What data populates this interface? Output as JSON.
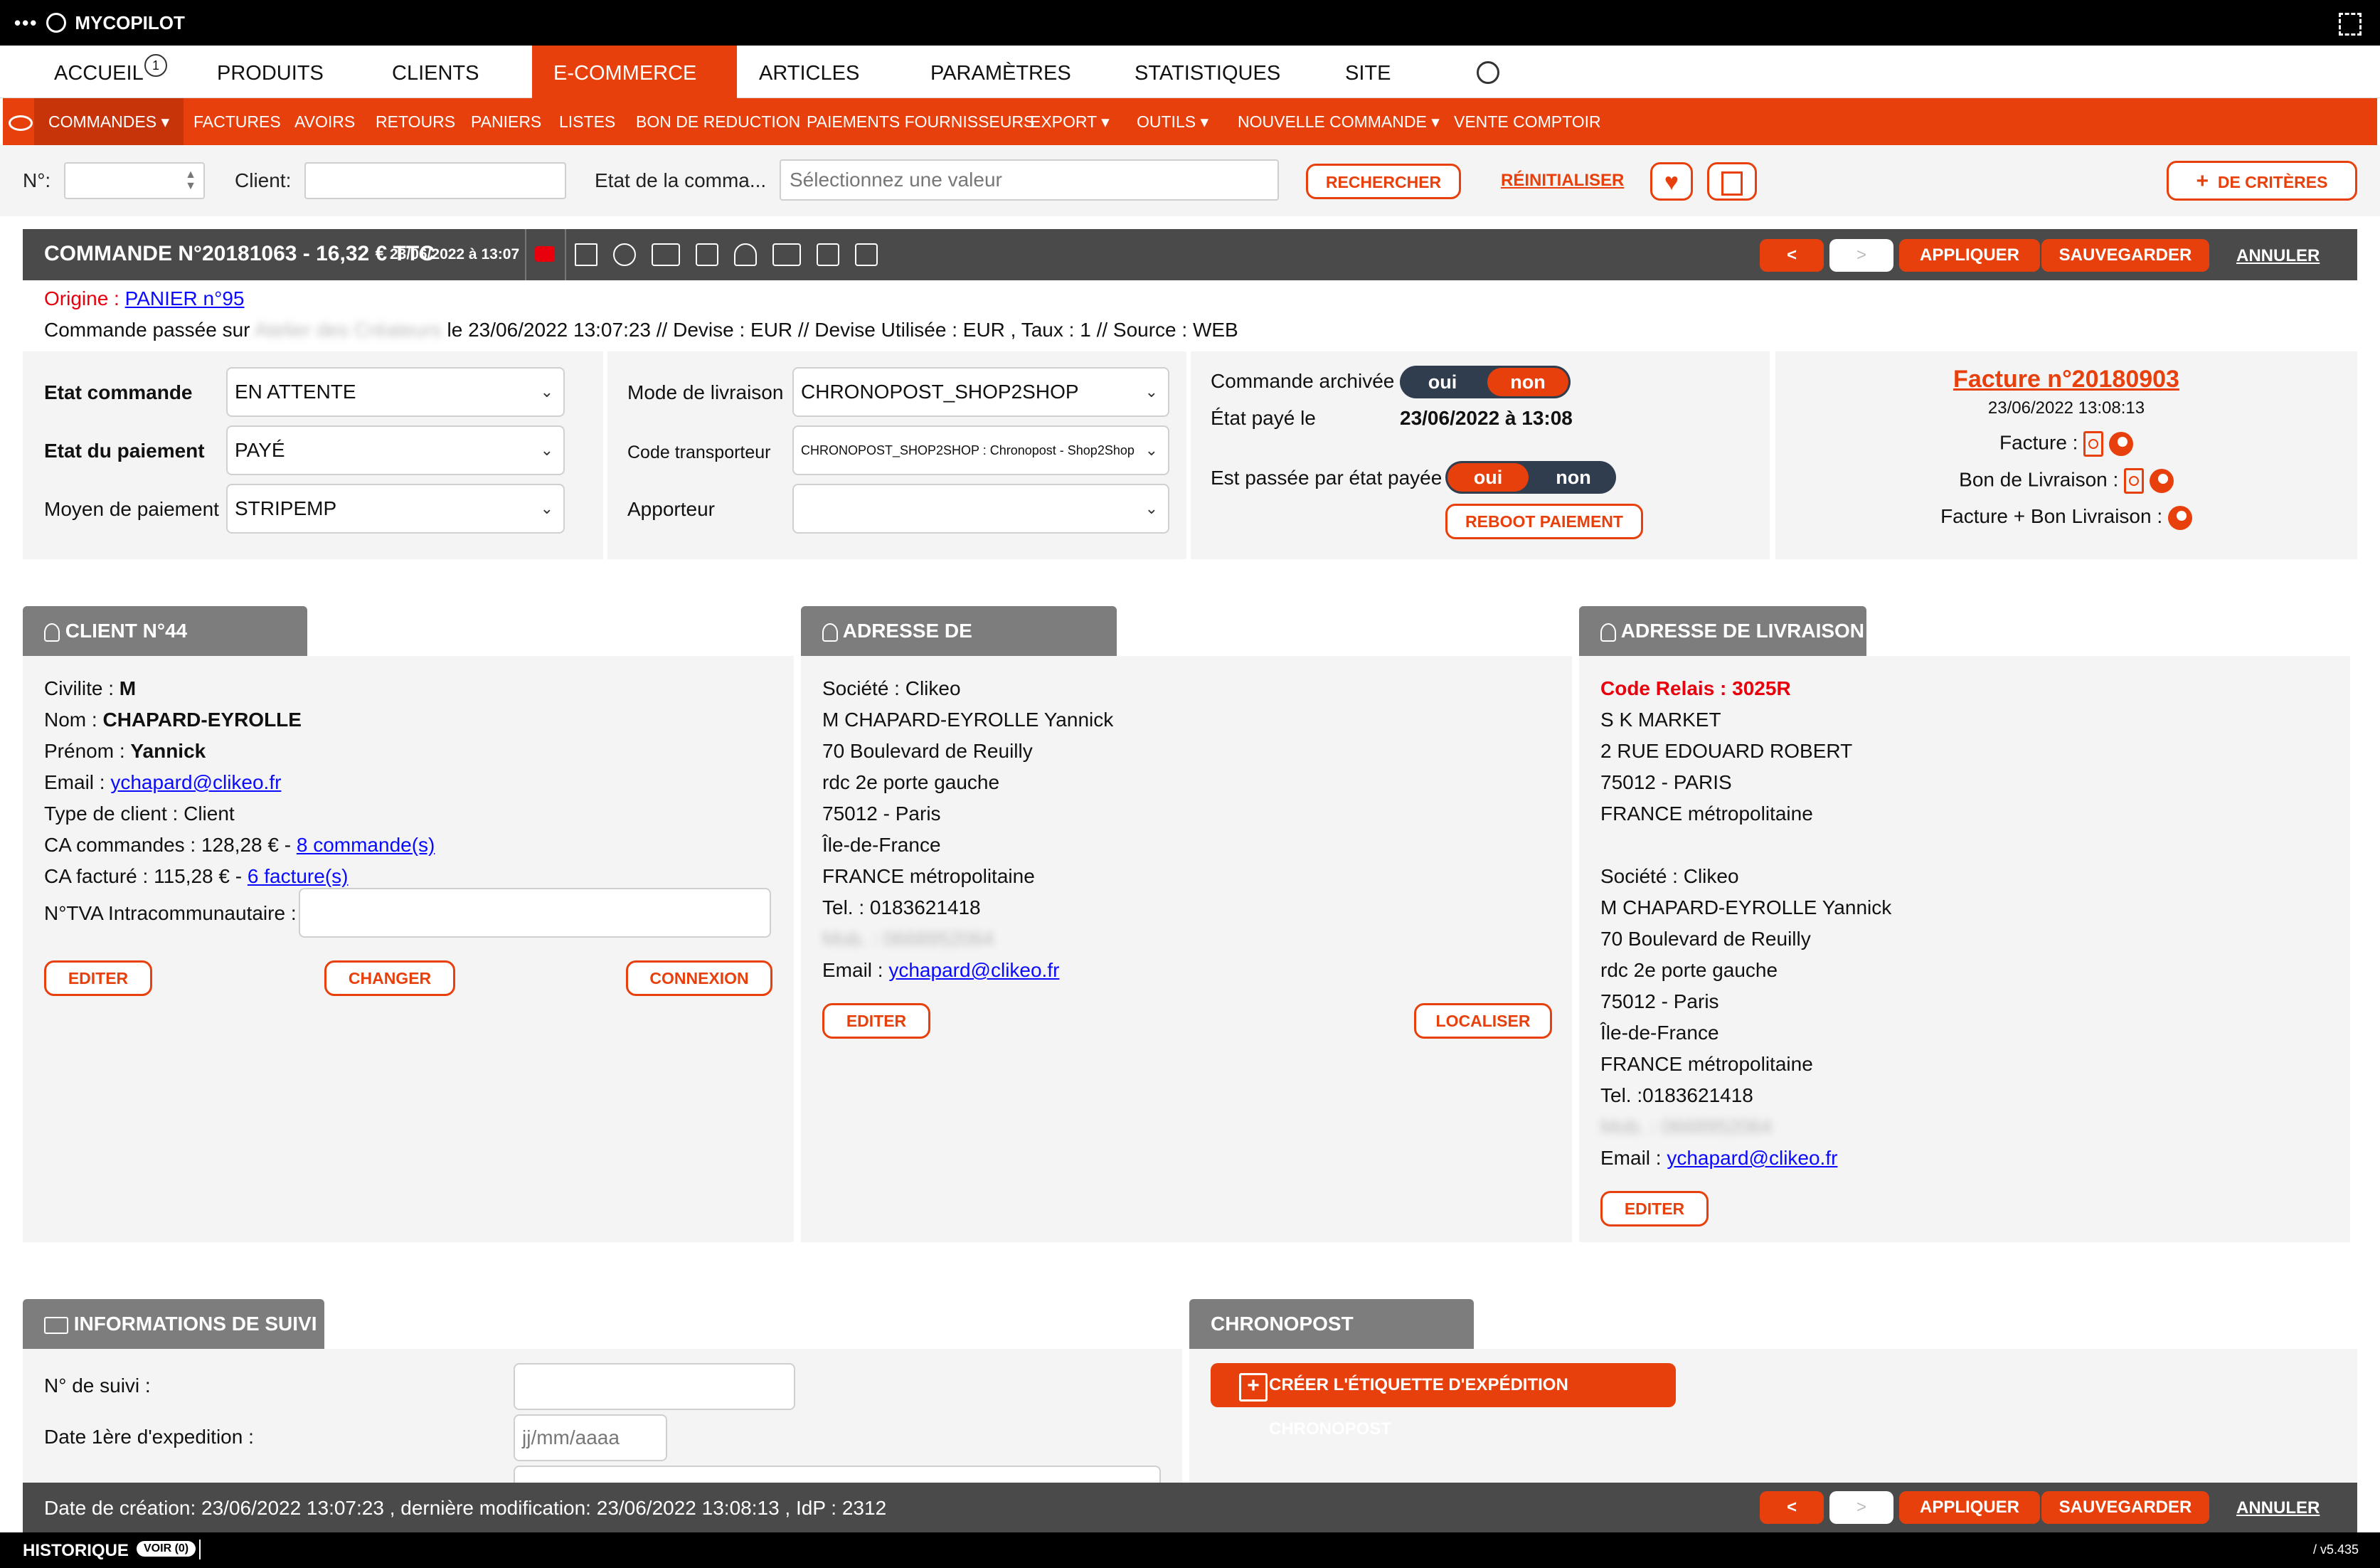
{
  "app": {
    "title": "MYCOPILOT"
  },
  "nav_main": {
    "items": [
      "ACCUEIL",
      "PRODUITS",
      "CLIENTS",
      "E-COMMERCE",
      "ARTICLES",
      "PARAMÈTRES",
      "STATISTIQUES",
      "SITE"
    ],
    "badge": "1"
  },
  "nav_sub": {
    "items": [
      "COMMANDES",
      "FACTURES",
      "AVOIRS",
      "RETOURS",
      "PANIERS",
      "LISTES",
      "BON DE REDUCTION",
      "PAIEMENTS FOURNISSEURS",
      "EXPORT",
      "OUTILS",
      "NOUVELLE COMMANDE",
      "VENTE COMPTOIR"
    ]
  },
  "search": {
    "num_label": "N°:",
    "client_label": "Client:",
    "etat_label": "Etat de la comma...",
    "etat_placeholder": "Sélectionnez une valeur",
    "rechercher": "RECHERCHER",
    "reinitialiser": "RÉINITIALISER",
    "criteres": "DE CRITÈRES"
  },
  "order_bar": {
    "title": "COMMANDE N°20181063 - 16,32 € TTC",
    "date": "23/06/2022 à 13:07",
    "prev": "<",
    "next": ">",
    "appliquer": "APPLIQUER",
    "sauvegarder": "SAUVEGARDER",
    "annuler": "ANNULER"
  },
  "origine": {
    "label": "Origine :",
    "link": "PANIER n°95",
    "line_prefix": "Commande passée sur",
    "line_blur": "Atelier des Créateurs",
    "line_suffix": "le 23/06/2022 13:07:23 // Devise : EUR // Devise Utilisée : EUR , Taux : 1 // Source : WEB"
  },
  "status": {
    "etat_commande_label": "Etat commande",
    "etat_commande": "EN ATTENTE",
    "etat_paiement_label": "Etat du paiement",
    "etat_paiement": "PAYÉ",
    "moyen_label": "Moyen de paiement",
    "moyen": "STRIPEMP",
    "mode_livraison_label": "Mode de livraison",
    "mode_livraison": "CHRONOPOST_SHOP2SHOP",
    "code_transporteur_label": "Code transporteur",
    "code_transporteur": "CHRONOPOST_SHOP2SHOP : Chronopost - Shop2Shop",
    "apporteur_label": "Apporteur",
    "apporteur": "",
    "archivee_label": "Commande archivée",
    "oui": "oui",
    "non": "non",
    "paye_le_label": "État payé le",
    "paye_le": "23/06/2022 à 13:08",
    "passee_label": "Est passée par état payée",
    "reboot": "REBOOT PAIEMENT"
  },
  "facture": {
    "title": "Facture n°20180903",
    "date": "23/06/2022 13:08:13",
    "facture_label": "Facture :",
    "bl_label": "Bon de Livraison :",
    "fbl_label": "Facture + Bon Livraison :"
  },
  "client": {
    "header": "CLIENT N°44",
    "civilite_label": "Civilite :",
    "civilite": "M",
    "nom_label": "Nom :",
    "nom": "CHAPARD-EYROLLE",
    "prenom_label": "Prénom :",
    "prenom": "Yannick",
    "email_label": "Email :",
    "email": "ychapard@clikeo.fr",
    "type_label": "Type de client : Client",
    "ca_cmd_text": "CA commandes : 128,28 € -",
    "ca_cmd_link": "8 commande(s)",
    "ca_fact_text": "CA facturé : 115,28 € -",
    "ca_fact_link": "6 facture(s)",
    "tva_label": "N°TVA Intracommunautaire :",
    "editer": "EDITER",
    "changer": "CHANGER",
    "connexion": "CONNEXION"
  },
  "facturation": {
    "header": "ADRESSE DE FACTURATION",
    "lines": [
      "Société : Clikeo",
      "M CHAPARD-EYROLLE Yannick",
      "70 Boulevard de Reuilly",
      "rdc 2e porte gauche",
      "75012 - Paris",
      "Île-de-France",
      "FRANCE métropolitaine",
      "Tel. : 0183621418"
    ],
    "blur": "Mob. : 0668952064",
    "email_label": "Email :",
    "email": "ychapard@clikeo.fr",
    "editer": "EDITER",
    "localiser": "LOCALISER"
  },
  "livraison": {
    "header": "ADRESSE DE LIVRAISON",
    "relais": "Code Relais : 3025R",
    "lines1": [
      "S K MARKET",
      "2 RUE EDOUARD ROBERT",
      "75012 - PARIS",
      "FRANCE métropolitaine"
    ],
    "lines2": [
      "Société : Clikeo",
      "M CHAPARD-EYROLLE Yannick",
      "70 Boulevard de Reuilly",
      "rdc 2e porte gauche",
      "75012 - Paris",
      "Île-de-France",
      "FRANCE métropolitaine",
      "Tel. :0183621418"
    ],
    "blur": "Mob. : 0668952064",
    "email_label": "Email :",
    "email": "ychapard@clikeo.fr",
    "editer": "EDITER"
  },
  "suivi": {
    "header": "INFORMATIONS DE SUIVI",
    "num_label": "N° de suivi :",
    "date_label": "Date 1ère d'expedition :",
    "date_placeholder": "jj/mm/aaaa"
  },
  "chronopost": {
    "header": "CHRONOPOST",
    "button": "CRÉER L'ÉTIQUETTE D'EXPÉDITION CHRONOPOST"
  },
  "footer_bar": {
    "text": "Date de création: 23/06/2022 13:07:23 , dernière modification: 23/06/2022 13:08:13 , IdP : 2312"
  },
  "bottom": {
    "historique": "HISTORIQUE",
    "voir": "VOIR (0)",
    "version": "/ v5.435"
  },
  "colors": {
    "accent": "#e8400c",
    "dark": "#4a4a4a",
    "panel": "#f4f4f4",
    "link": "#0a0aff",
    "relais": "#e8000c"
  }
}
